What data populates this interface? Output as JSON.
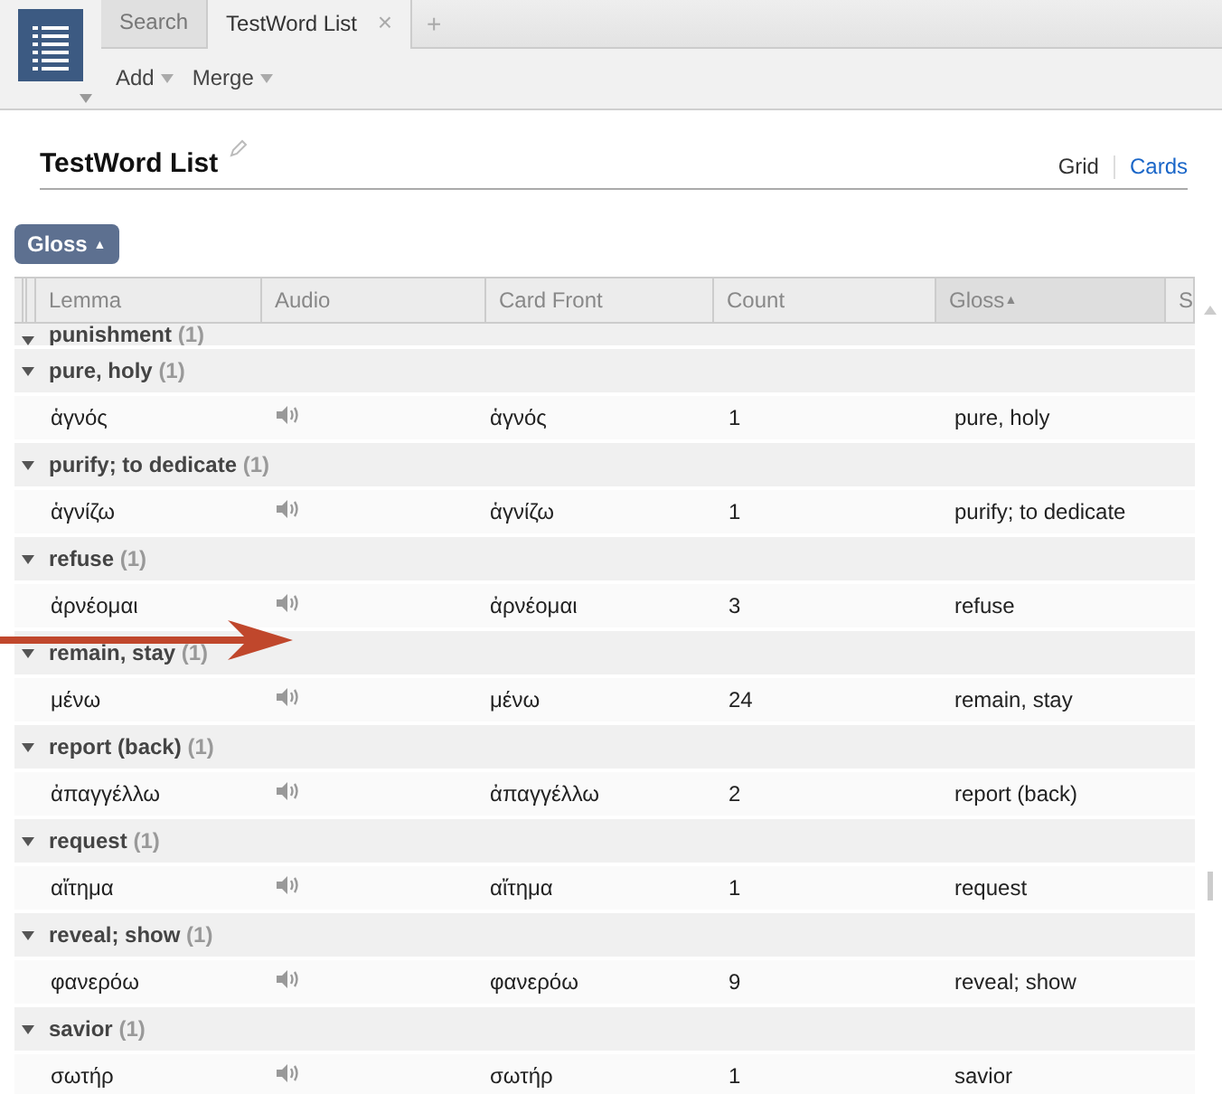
{
  "tabs": [
    {
      "label": "Search",
      "selected": false
    },
    {
      "label": "TestWord List",
      "selected": true,
      "close": "×"
    }
  ],
  "new_tab": "+",
  "toolbar": [
    "Add",
    "Merge"
  ],
  "title": "TestWord List",
  "views": [
    {
      "label": "Grid",
      "selected": true
    },
    {
      "label": "Cards",
      "selected": false
    }
  ],
  "group_by": {
    "label": "Gloss",
    "sort": "▲"
  },
  "table": {
    "columns": [
      {
        "label": "Lemma",
        "sorted": false
      },
      {
        "label": "Audio",
        "sorted": false
      },
      {
        "label": "Card Front",
        "sorted": false
      },
      {
        "label": "Count",
        "sorted": false
      },
      {
        "label": "Gloss",
        "sorted": true
      },
      {
        "label": "S",
        "sorted": false
      }
    ],
    "sort_mark": "▲",
    "groups": [
      {
        "label": "punishment",
        "count": "(1)",
        "expanded": true
      },
      {
        "label": "pure, holy",
        "count": "(1)",
        "expanded": true,
        "rows": [
          {
            "lemma": "ἁγνός",
            "card_front": "ἁγνός",
            "count": "1",
            "gloss": "pure, holy"
          }
        ]
      },
      {
        "label": "purify; to dedicate",
        "count": "(1)",
        "expanded": true,
        "rows": [
          {
            "lemma": "ἁγνίζω",
            "card_front": "ἁγνίζω",
            "count": "1",
            "gloss": "purify; to dedicate"
          }
        ]
      },
      {
        "label": "refuse",
        "count": "(1)",
        "expanded": true,
        "rows": [
          {
            "lemma": "ἀρνέομαι",
            "card_front": "ἀρνέομαι",
            "count": "3",
            "gloss": "refuse"
          }
        ]
      },
      {
        "label": "remain, stay",
        "count": "(1)",
        "expanded": true,
        "rows": [
          {
            "lemma": "μένω",
            "card_front": "μένω",
            "count": "24",
            "gloss": "remain, stay"
          }
        ]
      },
      {
        "label": "report (back)",
        "count": "(1)",
        "expanded": true,
        "rows": [
          {
            "lemma": "ἀπαγγέλλω",
            "card_front": "ἀπαγγέλλω",
            "count": "2",
            "gloss": "report (back)"
          }
        ]
      },
      {
        "label": "request",
        "count": "(1)",
        "expanded": true,
        "rows": [
          {
            "lemma": "αἴτημα",
            "card_front": "αἴτημα",
            "count": "1",
            "gloss": "request"
          }
        ]
      },
      {
        "label": "reveal; show",
        "count": "(1)",
        "expanded": true,
        "rows": [
          {
            "lemma": "φανερόω",
            "card_front": "φανερόω",
            "count": "9",
            "gloss": "reveal; show"
          }
        ]
      },
      {
        "label": "savior",
        "count": "(1)",
        "expanded": true,
        "rows": [
          {
            "lemma": "σωτήρ",
            "card_front": "σωτήρ",
            "count": "1",
            "gloss": "savior"
          }
        ]
      }
    ]
  }
}
